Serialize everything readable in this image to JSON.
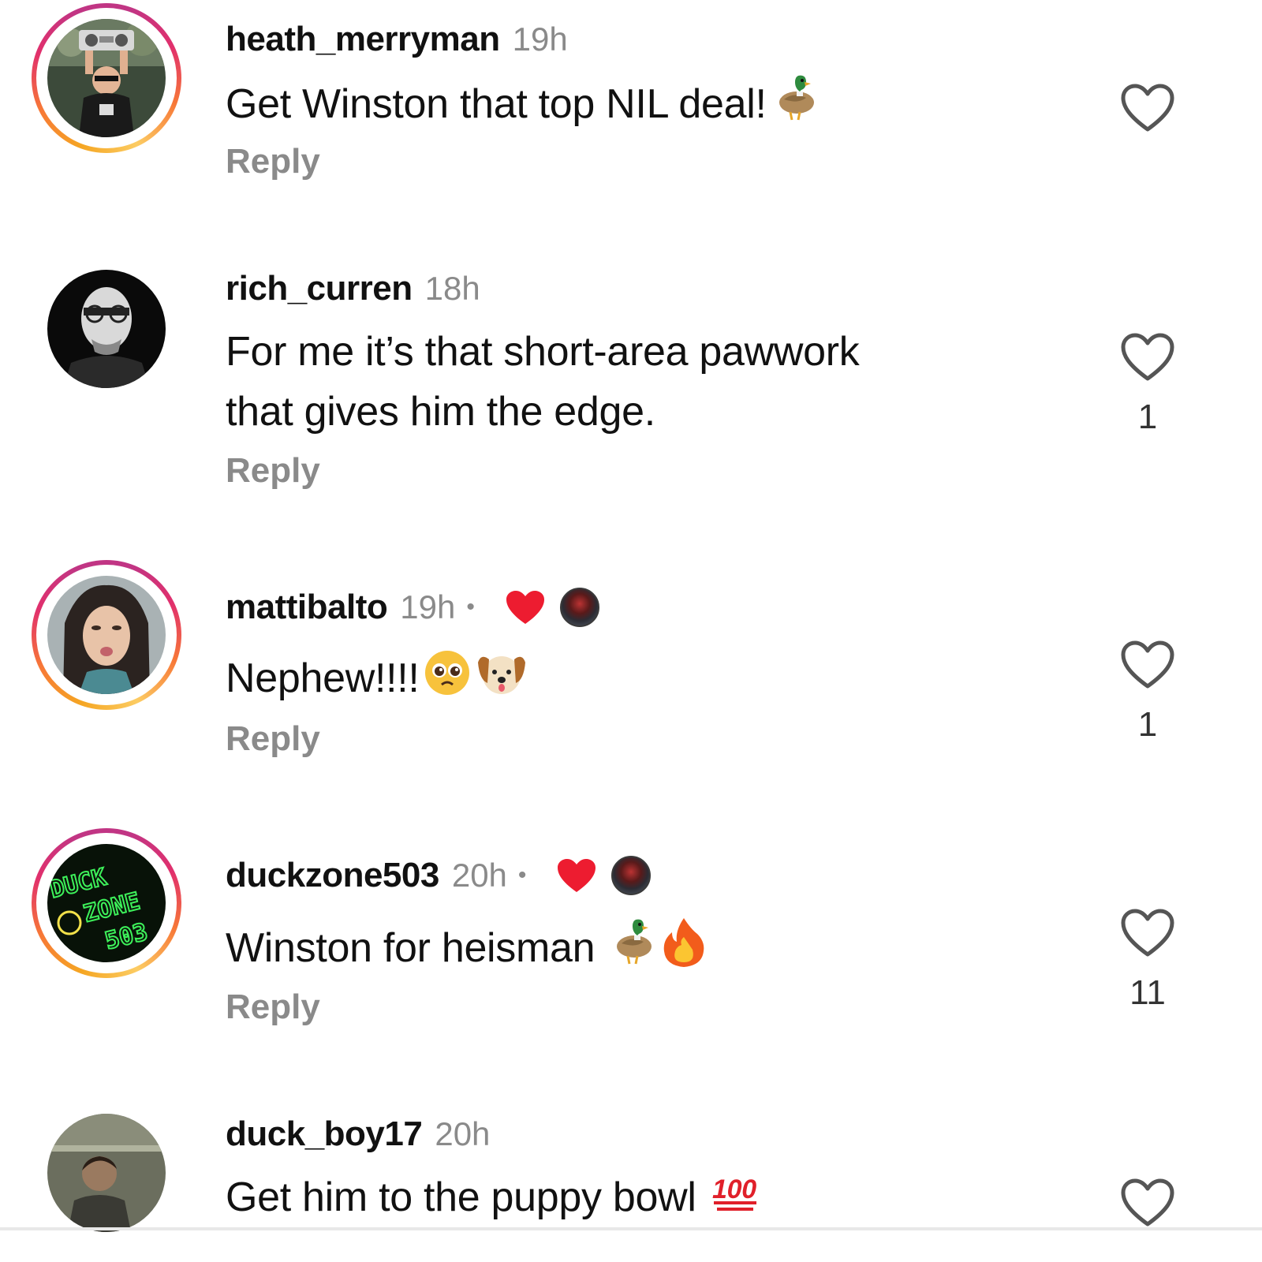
{
  "comments": [
    {
      "username": "heath_merryman",
      "time": "19h",
      "text": "Get Winston that top NIL deal!",
      "emojis": [
        "duck"
      ],
      "reply": "Reply",
      "likes": "",
      "story_ring": true,
      "author_liked": false
    },
    {
      "username": "rich_curren",
      "time": "18h",
      "text_line1": "For me it’s that short-area pawwork",
      "text_line2": "that gives him the edge.",
      "reply": "Reply",
      "likes": "1",
      "story_ring": false,
      "author_liked": false
    },
    {
      "username": "mattibalto",
      "time": "19h",
      "separator": "•",
      "text": "Nephew!!!!",
      "emojis": [
        "pleading-face",
        "dog-face"
      ],
      "reply": "Reply",
      "likes": "1",
      "story_ring": true,
      "author_liked": true
    },
    {
      "username": "duckzone503",
      "time": "20h",
      "separator": "•",
      "text": "Winston for heisman",
      "emojis": [
        "duck",
        "fire"
      ],
      "reply": "Reply",
      "likes": "11",
      "story_ring": true,
      "author_liked": true,
      "avatar_text": [
        "DUCK",
        "ZONE",
        "503"
      ]
    },
    {
      "username": "duck_boy17",
      "time": "20h",
      "text": "Get him to the puppy bowl",
      "emojis": [
        "hundred-points"
      ],
      "reply": "",
      "likes": "",
      "story_ring": false,
      "author_liked": false
    }
  ],
  "hundred_label": "100",
  "colors": {
    "heart_red": "#ed1c30",
    "muted_gray": "#8a8a8a",
    "ring_orange": "#f5a623",
    "ring_pink": "#c13584"
  },
  "icons": [
    "heart-outline-icon",
    "heart-filled-icon",
    "duck-emoji",
    "fire-emoji",
    "pleading-face-emoji",
    "dog-face-emoji",
    "hundred-points-emoji"
  ]
}
